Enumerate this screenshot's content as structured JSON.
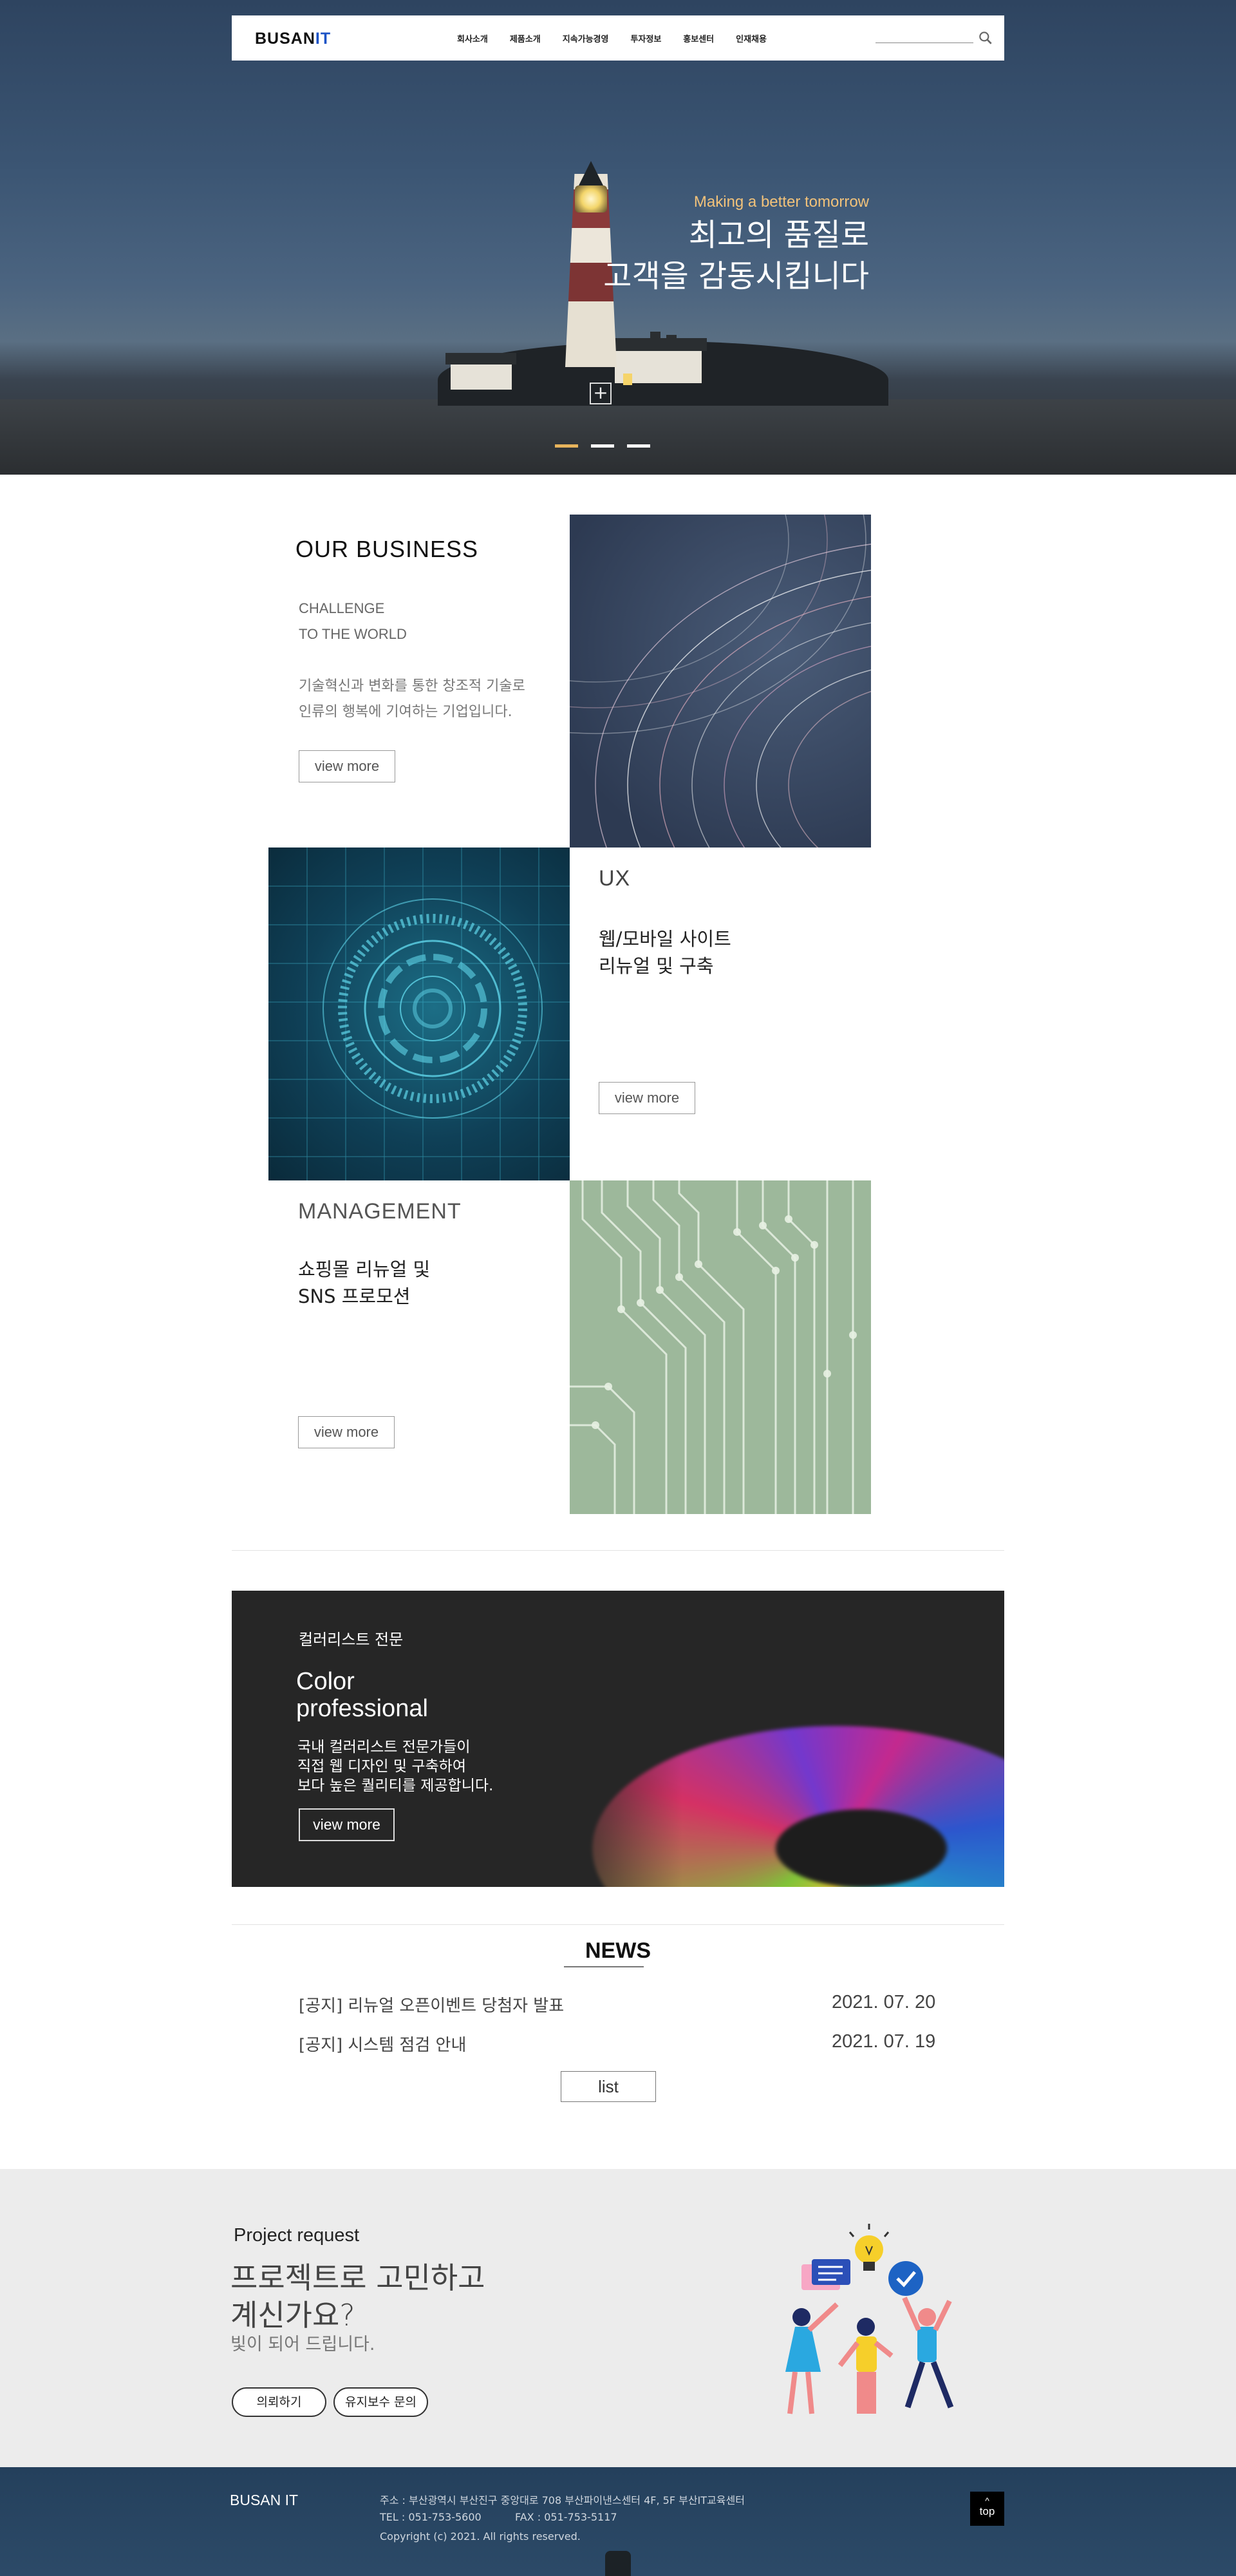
{
  "header": {
    "logo_main": "BUSAN",
    "logo_accent": "IT",
    "menu": [
      {
        "label": "회사소개"
      },
      {
        "label": "제품소개"
      },
      {
        "label": "지속가능경영"
      },
      {
        "label": "투자정보"
      },
      {
        "label": "홍보센터"
      },
      {
        "label": "인재채용"
      }
    ],
    "search_icon": "search-icon"
  },
  "hero": {
    "subtitle": "Making a better tomorrow",
    "title_line1": "최고의 품질로",
    "title_line2": "고객을 감동시킵니다",
    "plus": "+",
    "active_slide": 1,
    "slide_count": 3,
    "accent_color": "#e8b45c"
  },
  "business": {
    "title": "OUR BUSINESS",
    "sub_line1": "CHALLENGE",
    "sub_line2": "TO THE WORLD",
    "desc_line1": "기술혁신과 변화를 통한 창조적 기술로",
    "desc_line2": "인류의 행복에 기여하는 기업입니다.",
    "button": "view more"
  },
  "ux": {
    "title": "UX",
    "desc_line1": "웹/모바일 사이트",
    "desc_line2": "리뉴얼 및 구축",
    "button": "view more"
  },
  "management": {
    "title": "MANAGEMENT",
    "desc_line1": "쇼핑몰 리뉴얼 및",
    "desc_line2": "SNS 프로모션",
    "button": "view more"
  },
  "color_banner": {
    "small": "컬러리스트 전문",
    "title_line1": "Color",
    "title_line2": "professional",
    "desc_line1": "국내 컬러리스트 전문가들이",
    "desc_line2": "직접 웹 디자인 및 구축하여",
    "desc_line3": "보다 높은 퀄리티를 제공합니다.",
    "button": "view more"
  },
  "news": {
    "title": "NEWS",
    "items": [
      {
        "title": "[공지] 리뉴얼 오픈이벤트 당첨자 발표",
        "date": "2021. 07. 20"
      },
      {
        "title": "[공지] 시스템 점검 안내",
        "date": "2021. 07. 19"
      }
    ],
    "list_button": "list"
  },
  "request": {
    "small": "Project request",
    "big_line1": "프로젝트로 고민하고",
    "big_line2": "계신가요?",
    "sub": "빛이 되어 드립니다.",
    "button1": "의뢰하기",
    "button2": "유지보수 문의"
  },
  "footer": {
    "logo": "BUSAN IT",
    "address": "주소 : 부산광역시 부산진구 중앙대로 708 부산파이낸스센터 4F, 5F 부산IT교육센터",
    "tel": "TEL : 051-753-5600",
    "fax": "FAX : 051-753-5117",
    "copyright": "Copyright (c) 2021. All rights reserved.",
    "top_arrow": "^",
    "top_button": "top"
  }
}
